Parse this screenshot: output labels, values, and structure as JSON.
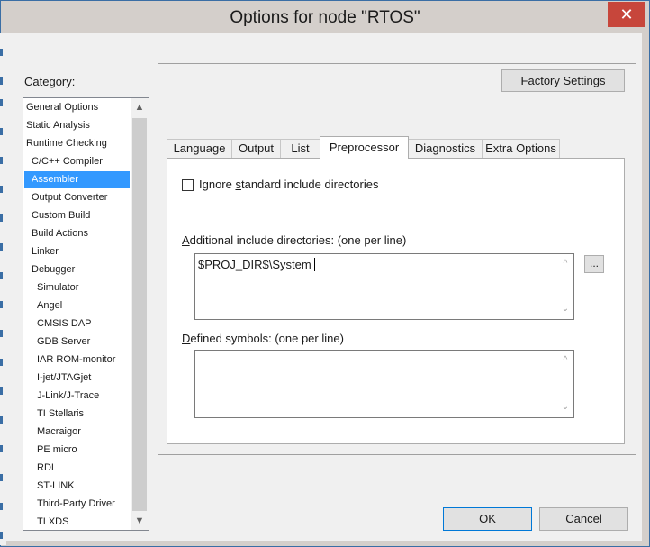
{
  "window": {
    "title": "Options for node \"RTOS\"",
    "close_glyph": "✕"
  },
  "category": {
    "label": "Category:",
    "items": [
      {
        "label": "General Options",
        "indent": 0
      },
      {
        "label": "Static Analysis",
        "indent": 0
      },
      {
        "label": "Runtime Checking",
        "indent": 0
      },
      {
        "label": "C/C++ Compiler",
        "indent": 1
      },
      {
        "label": "Assembler",
        "indent": 1,
        "selected": true
      },
      {
        "label": "Output Converter",
        "indent": 1
      },
      {
        "label": "Custom Build",
        "indent": 1
      },
      {
        "label": "Build Actions",
        "indent": 1
      },
      {
        "label": "Linker",
        "indent": 1
      },
      {
        "label": "Debugger",
        "indent": 1
      },
      {
        "label": "Simulator",
        "indent": 2
      },
      {
        "label": "Angel",
        "indent": 2
      },
      {
        "label": "CMSIS DAP",
        "indent": 2
      },
      {
        "label": "GDB Server",
        "indent": 2
      },
      {
        "label": "IAR ROM-monitor",
        "indent": 2
      },
      {
        "label": "I-jet/JTAGjet",
        "indent": 2
      },
      {
        "label": "J-Link/J-Trace",
        "indent": 2
      },
      {
        "label": "TI Stellaris",
        "indent": 2
      },
      {
        "label": "Macraigor",
        "indent": 2
      },
      {
        "label": "PE micro",
        "indent": 2
      },
      {
        "label": "RDI",
        "indent": 2
      },
      {
        "label": "ST-LINK",
        "indent": 2
      },
      {
        "label": "Third-Party Driver",
        "indent": 2
      },
      {
        "label": "TI XDS",
        "indent": 2
      }
    ]
  },
  "factory_settings_label": "Factory Settings",
  "tabs": [
    {
      "label": "Language"
    },
    {
      "label": "Output"
    },
    {
      "label": "List"
    },
    {
      "label": "Preprocessor",
      "active": true
    },
    {
      "label": "Diagnostics"
    },
    {
      "label": "Extra Options"
    }
  ],
  "preprocessor": {
    "ignore_std_checked": false,
    "ignore_std_label_pre": "Ignore ",
    "ignore_std_label_u": "s",
    "ignore_std_label_post": "tandard include directories",
    "include_dirs_label_u": "A",
    "include_dirs_label_post": "dditional include directories:  (one per line)",
    "include_dirs_value": "$PROJ_DIR$\\System",
    "browse_label": "...",
    "defined_symbols_label_u": "D",
    "defined_symbols_label_post": "efined symbols:  (one per line)",
    "defined_symbols_value": ""
  },
  "ok_label": "OK",
  "cancel_label": "Cancel",
  "icons": {
    "scroll_up": "chevron-up-icon",
    "scroll_down": "chevron-down-icon",
    "close": "close-icon"
  }
}
